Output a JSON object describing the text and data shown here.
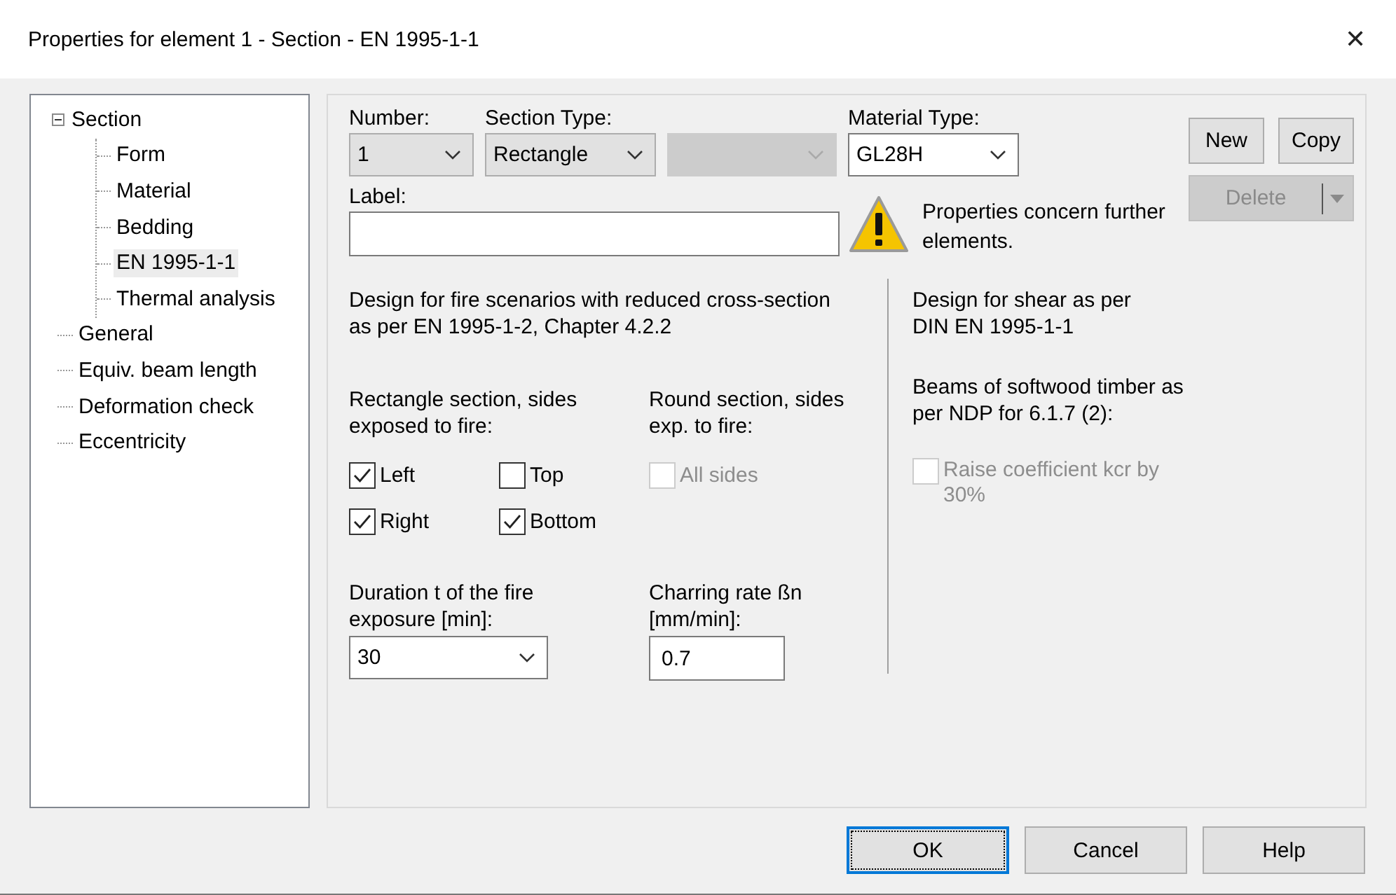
{
  "window": {
    "title": "Properties for element 1 - Section - EN 1995-1-1",
    "close": "✕"
  },
  "tree": [
    {
      "label": "Section",
      "expanded": true,
      "selected": false,
      "children": [
        {
          "label": "Form",
          "selected": false
        },
        {
          "label": "Material",
          "selected": false
        },
        {
          "label": "Bedding",
          "selected": false
        },
        {
          "label": "EN 1995-1-1",
          "selected": true
        },
        {
          "label": "Thermal analysis",
          "selected": false
        }
      ]
    },
    {
      "label": "General",
      "selected": false
    },
    {
      "label": "Equiv. beam length",
      "selected": false
    },
    {
      "label": "Deformation check",
      "selected": false
    },
    {
      "label": "Eccentricity",
      "selected": false
    }
  ],
  "header": {
    "number": {
      "label": "Number:",
      "value": "1"
    },
    "section_type": {
      "label": "Section Type:",
      "value": "Rectangle"
    },
    "subtype": {
      "disabled": true
    },
    "material_type": {
      "label": "Material Type:",
      "value": "GL28H"
    },
    "new_button": "New",
    "copy_button": "Copy",
    "delete_button": {
      "label": "Delete",
      "disabled": true
    },
    "label_field": {
      "label": "Label:"
    },
    "warning": "Properties concern further elements."
  },
  "fire": {
    "intro": "Design for fire scenarios with reduced cross-section as per EN 1995-1-2, Chapter 4.2.2",
    "rect_label": "Rectangle section, sides exposed to fire:",
    "rect_sides": [
      {
        "label": "Left",
        "checked": true,
        "disabled": false
      },
      {
        "label": "Top",
        "checked": false,
        "disabled": false
      },
      {
        "label": "Right",
        "checked": true,
        "disabled": false
      },
      {
        "label": "Bottom",
        "checked": true,
        "disabled": false
      }
    ],
    "round_label": "Round section, sides exp. to fire:",
    "round_sides": [
      {
        "label": "All sides",
        "checked": false,
        "disabled": true
      }
    ],
    "duration": {
      "label": "Duration t of the fire exposure [min]:",
      "value": "30"
    },
    "charring": {
      "label": "Charring rate ßn [mm/min]:",
      "value": "0.7"
    }
  },
  "shear": {
    "intro": "Design for shear as per DIN EN 1995-1-1",
    "ndp_label": "Beams of softwood timber as per NDP for 6.1.7 (2):",
    "options": [
      {
        "label": "Raise coefficient kcr by 30%",
        "checked": false,
        "disabled": true
      }
    ]
  },
  "footer": [
    {
      "label": "OK",
      "default": true
    },
    {
      "label": "Cancel",
      "default": false
    },
    {
      "label": "Help",
      "default": false
    }
  ]
}
